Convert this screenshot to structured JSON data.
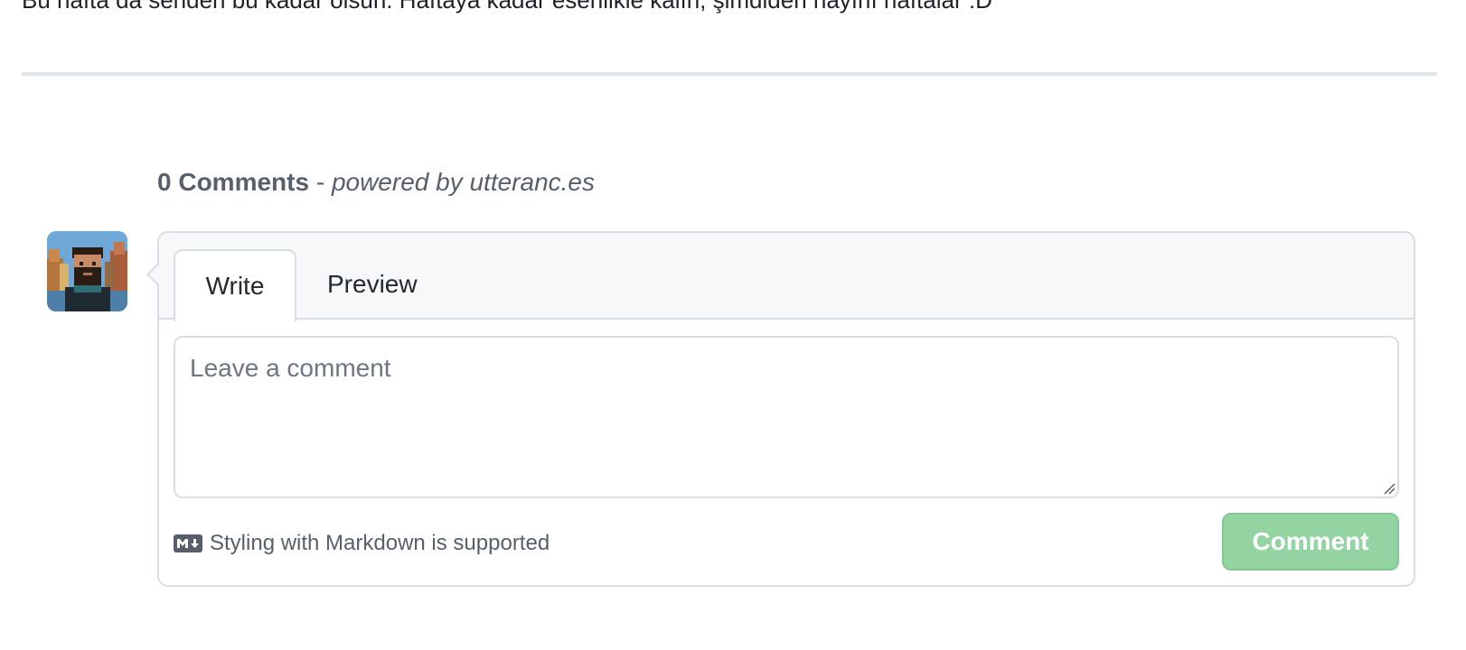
{
  "article": {
    "trailing_text": "Bu hafta da senden bu kadar olsun. Haftaya kadar esenlikle kalın, şimdiden hayırlı haftalar :D"
  },
  "comments": {
    "count_label": "0 Comments",
    "separator": " - ",
    "powered_by": "powered by utteranc.es"
  },
  "editor": {
    "tabs": [
      {
        "label": "Write",
        "active": true
      },
      {
        "label": "Preview",
        "active": false
      }
    ],
    "textarea_placeholder": "Leave a comment",
    "textarea_value": "",
    "markdown_note": "Styling with Markdown is supported",
    "submit_label": "Comment"
  },
  "colors": {
    "submit_disabled_bg": "#94d3a2",
    "border": "#d8dee4",
    "tab_bar_bg": "#f6f8fa",
    "muted_text": "#57606a"
  },
  "icons": {
    "markdown": "markdown-icon",
    "resize": "resize-grip-icon"
  }
}
